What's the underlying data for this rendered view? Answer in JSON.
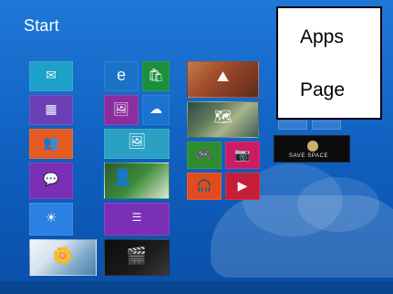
{
  "start": {
    "title": "Start"
  },
  "callout": {
    "line1": "Apps",
    "line2": "Page"
  },
  "tiles": [
    {
      "name": "mail-tile",
      "bg": "#1ea1c8",
      "icon": "✉"
    },
    {
      "name": "internet-explorer-tile",
      "bg": "#1a73c7",
      "icon": "e"
    },
    {
      "name": "store-tile",
      "bg": "#1c8f3a",
      "icon": "🛍"
    },
    {
      "name": "calendar-tile",
      "bg": "#6c3fb6",
      "icon": "▦"
    },
    {
      "name": "photos-tile",
      "bg": "#8c2ea0",
      "icon": "🖼"
    },
    {
      "name": "skydrive-tile",
      "bg": "#1b73d0",
      "icon": "☁"
    },
    {
      "name": "people-tile",
      "bg": "#e25b22",
      "icon": "👥"
    },
    {
      "name": "pictures-wide-tile",
      "bg": "#2aa0c2",
      "icon": "🖼"
    },
    {
      "name": "messaging-tile",
      "bg": "#7b2fb6",
      "icon": "💬"
    },
    {
      "name": "news-wide-tile",
      "bg": "#1e8a3c",
      "icon": ""
    },
    {
      "name": "weather-tile",
      "bg": "#2c7fe3",
      "icon": "☀"
    },
    {
      "name": "article-wide-tile",
      "bg": "#7b2fb6",
      "icon": ""
    },
    {
      "name": "desktop-tile",
      "bg": "#3b6fb1",
      "icon": ""
    },
    {
      "name": "video-wide-tile",
      "bg": "#0c0c0c",
      "icon": ""
    },
    {
      "name": "games-tile",
      "bg": "#2f8b2f",
      "icon": "🎮"
    },
    {
      "name": "camera-tile",
      "bg": "#cf1a65",
      "icon": "📷"
    },
    {
      "name": "music-tile",
      "bg": "#e34a1d",
      "icon": "🎧"
    },
    {
      "name": "video-tile",
      "bg": "#c51e37",
      "icon": "▶"
    }
  ],
  "logo": {
    "text": "SAVE SPACE"
  }
}
